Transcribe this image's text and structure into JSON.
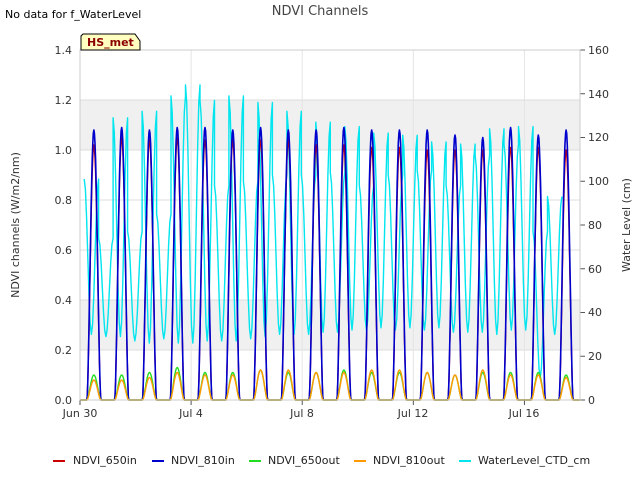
{
  "notice": "No data for f_WaterLevel",
  "badge": "HS_met",
  "chart_data": {
    "type": "line",
    "title": "NDVI Channels",
    "ylabel": "NDVI channels (W/m2/nm)",
    "y2label": "Water Level (cm)",
    "xlim": [
      "2023-06-30",
      "2023-07-18"
    ],
    "ylim": [
      0,
      1.4
    ],
    "y2lim": [
      0,
      160
    ],
    "x_ticks": [
      "Jun 30",
      "Jul 4",
      "Jul 8",
      "Jul 12",
      "Jul 16"
    ],
    "y_ticks": [
      "0.0",
      "0.2",
      "0.4",
      "0.6",
      "0.8",
      "1.0",
      "1.2",
      "1.4"
    ],
    "y2_ticks": [
      "0",
      "20",
      "40",
      "60",
      "80",
      "100",
      "120",
      "140",
      "160"
    ],
    "grid": true,
    "legend_position": "bottom",
    "series": [
      {
        "name": "NDVI_650in",
        "color": "#cc0000",
        "axis": "left",
        "daily_peak": [
          1.02,
          1.05,
          1.04,
          1.05,
          1.04,
          1.04,
          1.04,
          1.04,
          1.02,
          1.02,
          1.01,
          1.01,
          1.0,
          1.0,
          1.0,
          1.01,
          1.01,
          1.0,
          1.02
        ],
        "night_value": 0.0
      },
      {
        "name": "NDVI_810in",
        "color": "#0000cc",
        "axis": "left",
        "daily_peak": [
          1.08,
          1.09,
          1.08,
          1.09,
          1.09,
          1.08,
          1.09,
          1.08,
          1.08,
          1.09,
          1.08,
          1.08,
          1.08,
          1.06,
          1.05,
          1.09,
          1.06,
          1.08,
          1.08
        ],
        "night_value": 0.0
      },
      {
        "name": "NDVI_650out",
        "color": "#22dd22",
        "axis": "left",
        "daily_peak": [
          0.1,
          0.1,
          0.11,
          0.13,
          0.11,
          0.11,
          0.12,
          0.11,
          0.11,
          0.12,
          0.11,
          0.11,
          0.11,
          0.1,
          0.11,
          0.11,
          0.11,
          0.1,
          0.1
        ],
        "night_value": 0.0
      },
      {
        "name": "NDVI_810out",
        "color": "#ff9900",
        "axis": "left",
        "daily_peak": [
          0.08,
          0.08,
          0.09,
          0.11,
          0.1,
          0.1,
          0.12,
          0.12,
          0.11,
          0.11,
          0.12,
          0.12,
          0.11,
          0.1,
          0.12,
          0.1,
          0.1,
          0.09,
          0.09
        ],
        "night_value": 0.0
      },
      {
        "name": "WaterLevel_CTD_cm",
        "color": "#00e5ee",
        "axis": "right",
        "highs": [
          101,
          74,
          129,
          77,
          132,
          85,
          139,
          144,
          137,
          98,
          139,
          100,
          136,
          103,
          132,
          103,
          127,
          104,
          125,
          98,
          122,
          103,
          121,
          105,
          118,
          98,
          117,
          112,
          124,
          117,
          125,
          77,
          93
        ],
        "lows": [
          30,
          29,
          29,
          27,
          26,
          28,
          26,
          26,
          27,
          27,
          27,
          28,
          29,
          30,
          30,
          30,
          31,
          31,
          32,
          32,
          33,
          32,
          33,
          32,
          33,
          31,
          31,
          31,
          30,
          32,
          32,
          10,
          30
        ]
      }
    ]
  }
}
